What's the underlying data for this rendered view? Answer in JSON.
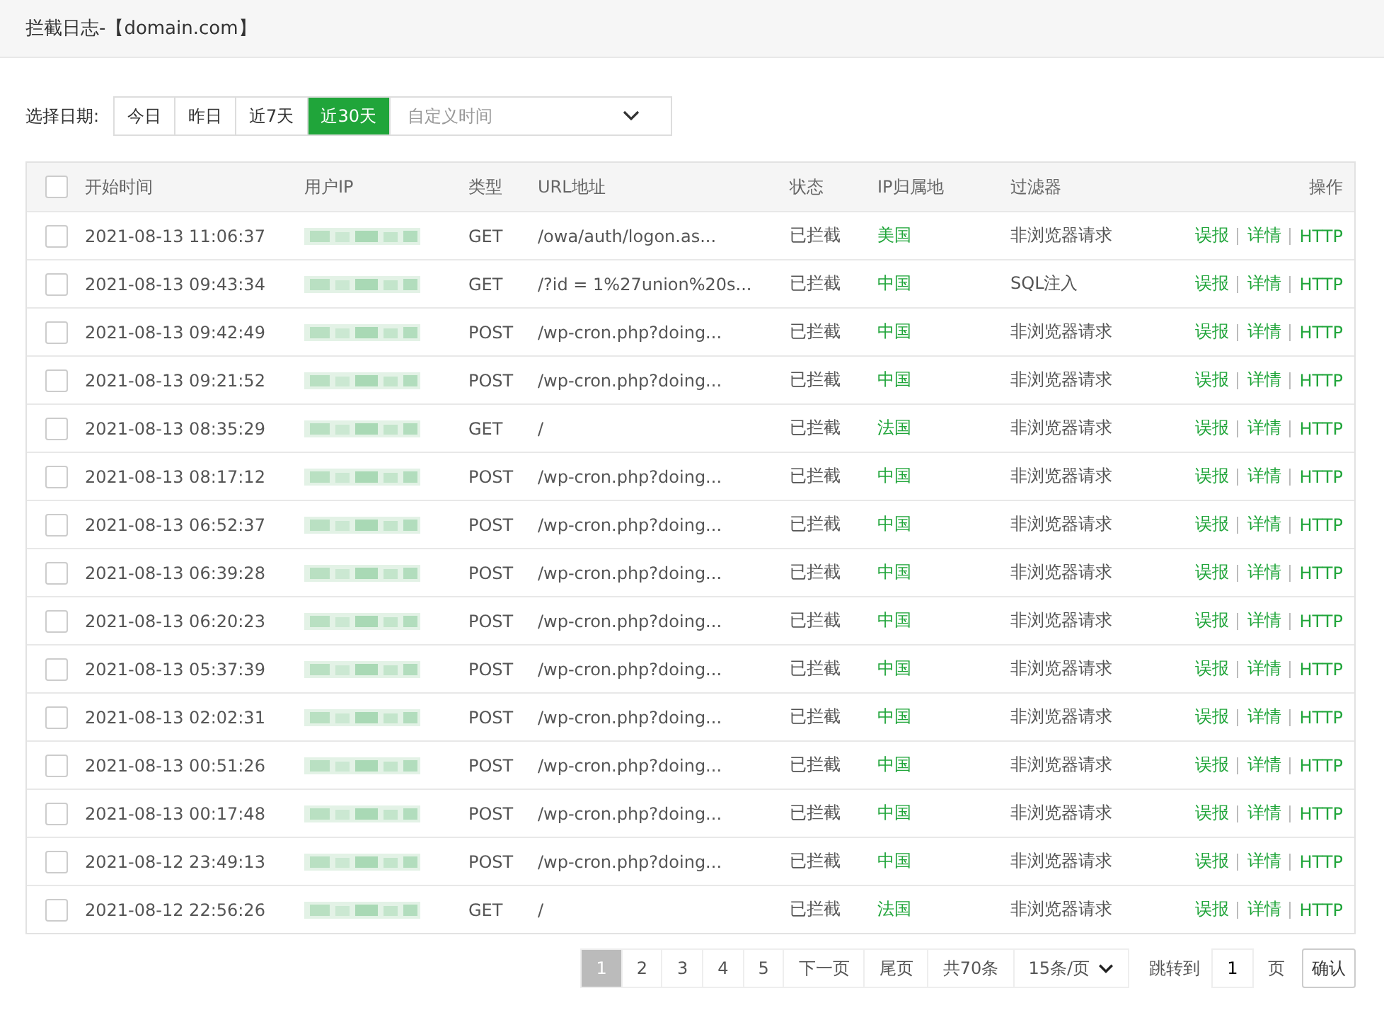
{
  "header": {
    "title": "拦截日志-【domain.com】"
  },
  "date_filter": {
    "label": "选择日期:",
    "options": [
      {
        "label": "今日",
        "selected": false
      },
      {
        "label": "昨日",
        "selected": false
      },
      {
        "label": "近7天",
        "selected": false
      },
      {
        "label": "近30天",
        "selected": true
      }
    ],
    "custom": {
      "placeholder": "自定义时间"
    }
  },
  "table": {
    "columns": [
      "开始时间",
      "用户IP",
      "类型",
      "URL地址",
      "状态",
      "IP归属地",
      "过滤器",
      "操作"
    ],
    "rows": [
      {
        "checked": false,
        "time": "2021-08-13 11:06:37",
        "method": "GET",
        "url": "/owa/auth/logon.as...",
        "status": "已拦截",
        "location": "美国",
        "filter": "非浏览器请求",
        "actions": [
          "误报",
          "详情",
          "HTTP"
        ]
      },
      {
        "checked": false,
        "time": "2021-08-13 09:43:34",
        "method": "GET",
        "url": "/?id = 1%27union%20s...",
        "status": "已拦截",
        "location": "中国",
        "filter": "SQL注入",
        "actions": [
          "误报",
          "详情",
          "HTTP"
        ]
      },
      {
        "checked": false,
        "time": "2021-08-13 09:42:49",
        "method": "POST",
        "url": "/wp-cron.php?doing...",
        "status": "已拦截",
        "location": "中国",
        "filter": "非浏览器请求",
        "actions": [
          "误报",
          "详情",
          "HTTP"
        ]
      },
      {
        "checked": false,
        "time": "2021-08-13 09:21:52",
        "method": "POST",
        "url": "/wp-cron.php?doing...",
        "status": "已拦截",
        "location": "中国",
        "filter": "非浏览器请求",
        "actions": [
          "误报",
          "详情",
          "HTTP"
        ]
      },
      {
        "checked": false,
        "time": "2021-08-13 08:35:29",
        "method": "GET",
        "url": "/",
        "status": "已拦截",
        "location": "法国",
        "filter": "非浏览器请求",
        "actions": [
          "误报",
          "详情",
          "HTTP"
        ]
      },
      {
        "checked": false,
        "time": "2021-08-13 08:17:12",
        "method": "POST",
        "url": "/wp-cron.php?doing...",
        "status": "已拦截",
        "location": "中国",
        "filter": "非浏览器请求",
        "actions": [
          "误报",
          "详情",
          "HTTP"
        ]
      },
      {
        "checked": false,
        "time": "2021-08-13 06:52:37",
        "method": "POST",
        "url": "/wp-cron.php?doing...",
        "status": "已拦截",
        "location": "中国",
        "filter": "非浏览器请求",
        "actions": [
          "误报",
          "详情",
          "HTTP"
        ]
      },
      {
        "checked": false,
        "time": "2021-08-13 06:39:28",
        "method": "POST",
        "url": "/wp-cron.php?doing...",
        "status": "已拦截",
        "location": "中国",
        "filter": "非浏览器请求",
        "actions": [
          "误报",
          "详情",
          "HTTP"
        ]
      },
      {
        "checked": false,
        "time": "2021-08-13 06:20:23",
        "method": "POST",
        "url": "/wp-cron.php?doing...",
        "status": "已拦截",
        "location": "中国",
        "filter": "非浏览器请求",
        "actions": [
          "误报",
          "详情",
          "HTTP"
        ]
      },
      {
        "checked": false,
        "time": "2021-08-13 05:37:39",
        "method": "POST",
        "url": "/wp-cron.php?doing...",
        "status": "已拦截",
        "location": "中国",
        "filter": "非浏览器请求",
        "actions": [
          "误报",
          "详情",
          "HTTP"
        ]
      },
      {
        "checked": false,
        "time": "2021-08-13 02:02:31",
        "method": "POST",
        "url": "/wp-cron.php?doing...",
        "status": "已拦截",
        "location": "中国",
        "filter": "非浏览器请求",
        "actions": [
          "误报",
          "详情",
          "HTTP"
        ]
      },
      {
        "checked": false,
        "time": "2021-08-13 00:51:26",
        "method": "POST",
        "url": "/wp-cron.php?doing...",
        "status": "已拦截",
        "location": "中国",
        "filter": "非浏览器请求",
        "actions": [
          "误报",
          "详情",
          "HTTP"
        ]
      },
      {
        "checked": false,
        "time": "2021-08-13 00:17:48",
        "method": "POST",
        "url": "/wp-cron.php?doing...",
        "status": "已拦截",
        "location": "中国",
        "filter": "非浏览器请求",
        "actions": [
          "误报",
          "详情",
          "HTTP"
        ]
      },
      {
        "checked": false,
        "time": "2021-08-12 23:49:13",
        "method": "POST",
        "url": "/wp-cron.php?doing...",
        "status": "已拦截",
        "location": "中国",
        "filter": "非浏览器请求",
        "actions": [
          "误报",
          "详情",
          "HTTP"
        ]
      },
      {
        "checked": false,
        "time": "2021-08-12 22:56:26",
        "method": "GET",
        "url": "/",
        "status": "已拦截",
        "location": "法国",
        "filter": "非浏览器请求",
        "actions": [
          "误报",
          "详情",
          "HTTP"
        ]
      }
    ],
    "select_all": false
  },
  "pagination": {
    "pages": [
      {
        "label": "1",
        "selected": true
      },
      {
        "label": "2",
        "selected": false
      },
      {
        "label": "3",
        "selected": false
      },
      {
        "label": "4",
        "selected": false
      },
      {
        "label": "5",
        "selected": false
      }
    ],
    "next": "下一页",
    "last": "尾页",
    "total": "共70条",
    "page_size": "15条/页",
    "jump_label": "跳转到",
    "jump_value": "1",
    "jump_unit": "页",
    "confirm": "确认"
  }
}
